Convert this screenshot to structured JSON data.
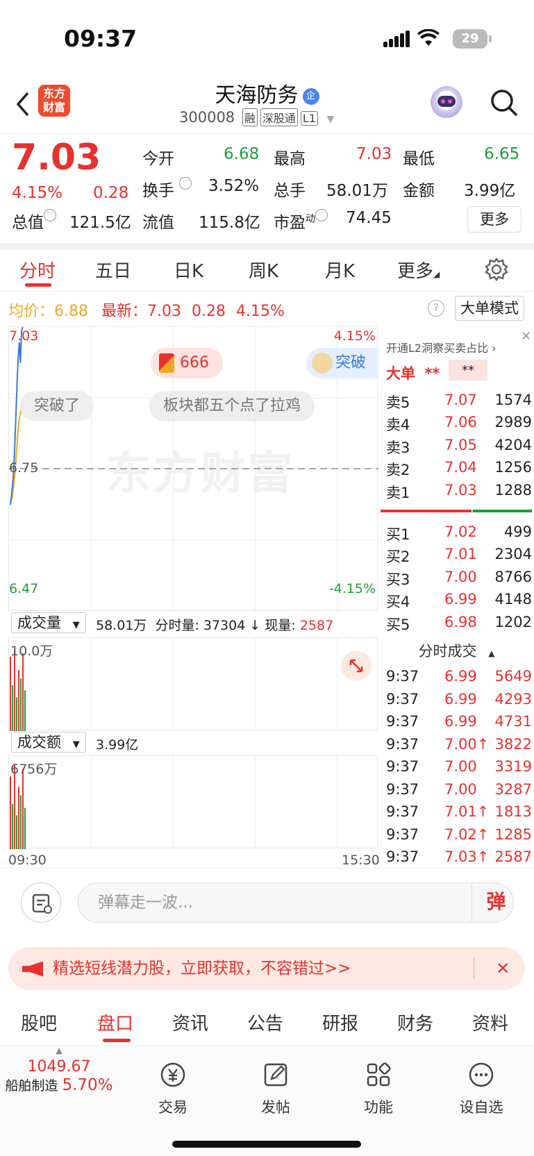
{
  "status": {
    "time": "09:37",
    "battery": "29"
  },
  "header": {
    "logo_line1": "东方",
    "logo_line2": "财富",
    "title": "天海防务",
    "title_badge": "企",
    "code": "300008",
    "tags": [
      "融",
      "深股通",
      "L1"
    ]
  },
  "quote": {
    "price": "7.03",
    "change_pct": "4.15%",
    "change": "0.28",
    "fields": [
      {
        "label": "今开",
        "value": "6.68",
        "color": "green"
      },
      {
        "label": "最高",
        "value": "7.03",
        "color": "red"
      },
      {
        "label": "最低",
        "value": "6.65",
        "color": "green"
      },
      {
        "label": "换手",
        "value": "3.52%"
      },
      {
        "label": "总手",
        "value": "58.01万"
      },
      {
        "label": "金额",
        "value": "3.99亿"
      },
      {
        "label": "总值",
        "value": "121.5亿"
      },
      {
        "label": "流值",
        "value": "115.8亿"
      },
      {
        "label": "市盈",
        "label_sup": "动",
        "value": "74.45"
      }
    ],
    "more_label": "更多"
  },
  "chart_tabs": [
    "分时",
    "五日",
    "日K",
    "周K",
    "月K",
    "更多"
  ],
  "info": {
    "avg_label": "均价：",
    "avg": "6.88",
    "latest_label": "最新：",
    "latest": "7.03",
    "change": "0.28",
    "pct": "4.15%",
    "mode_label": "大单模式"
  },
  "chart_data": [
    {
      "type": "line",
      "title": "",
      "ymax_label": "7.03",
      "ymin_label": "6.47",
      "mid_label": "6.75",
      "pct_top": "4.15%",
      "pct_bottom": "-4.15%",
      "ylim": [
        6.47,
        7.03
      ],
      "x_start": "09:30",
      "x_end": "15:30",
      "series": [
        {
          "values": [
            6.68,
            6.7,
            6.72,
            6.75,
            6.8,
            6.86,
            6.92,
            6.97,
            7.0,
            6.96,
            7.02,
            7.03
          ]
        },
        {
          "values": [
            6.68,
            6.69,
            6.7,
            6.72,
            6.74,
            6.77,
            6.8,
            6.83,
            6.85,
            6.86,
            6.87,
            6.88
          ]
        }
      ]
    },
    {
      "type": "bar",
      "title": "成交量",
      "total": "58.01万",
      "segment_label": "分时量:",
      "segment_value": "37304",
      "current_label": "现量:",
      "current_value": "2587",
      "ymax_label": "10.0万",
      "ylim": [
        0,
        100000
      ],
      "values": [
        88000,
        54000,
        96000,
        40000,
        72000,
        62000,
        92000,
        48000
      ]
    },
    {
      "type": "bar",
      "title": "成交额",
      "total": "3.99亿",
      "ymax_label": "6756万",
      "ylim": [
        0,
        6756
      ],
      "values": [
        5800,
        3600,
        6756,
        2700,
        5000,
        4300,
        6400,
        3300
      ]
    }
  ],
  "danmaku": [
    "666",
    "突破了",
    "板块都五个点了拉鸡",
    "突破"
  ],
  "watermark": "东方财富",
  "orderbook": {
    "banner": "开通L2洞察买卖占比 ›",
    "big_label": "大单",
    "big_val1": "**",
    "big_val2": "**",
    "asks": [
      {
        "label": "卖5",
        "price": "7.07",
        "vol": "1574"
      },
      {
        "label": "卖4",
        "price": "7.06",
        "vol": "2989"
      },
      {
        "label": "卖3",
        "price": "7.05",
        "vol": "4204"
      },
      {
        "label": "卖2",
        "price": "7.04",
        "vol": "1256"
      },
      {
        "label": "卖1",
        "price": "7.03",
        "vol": "1288"
      }
    ],
    "bids": [
      {
        "label": "买1",
        "price": "7.02",
        "vol": "499"
      },
      {
        "label": "买2",
        "price": "7.01",
        "vol": "2304"
      },
      {
        "label": "买3",
        "price": "7.00",
        "vol": "8766"
      },
      {
        "label": "买4",
        "price": "6.99",
        "vol": "4148"
      },
      {
        "label": "买5",
        "price": "6.98",
        "vol": "1202"
      }
    ],
    "buy_ratio": 0.6
  },
  "trades": {
    "title": "分时成交",
    "rows": [
      {
        "time": "9:37",
        "price": "6.99",
        "vol": "5649"
      },
      {
        "time": "9:37",
        "price": "6.99",
        "vol": "4293"
      },
      {
        "time": "9:37",
        "price": "6.99",
        "vol": "4731"
      },
      {
        "time": "9:37",
        "price": "7.00↑",
        "vol": "3822"
      },
      {
        "time": "9:37",
        "price": "7.00",
        "vol": "3319"
      },
      {
        "time": "9:37",
        "price": "7.00",
        "vol": "3287"
      },
      {
        "time": "9:37",
        "price": "7.01↑",
        "vol": "1813"
      },
      {
        "time": "9:37",
        "price": "7.02↑",
        "vol": "1285"
      },
      {
        "time": "9:37",
        "price": "7.03↑",
        "vol": "2587"
      }
    ]
  },
  "danmu_bar": {
    "placeholder": "弹幕走一波...",
    "button": "弹"
  },
  "promo": {
    "text": "精选短线潜力股，立即获取，不容错过>>"
  },
  "bottom_nav": [
    "股吧",
    "盘口",
    "资讯",
    "公告",
    "研报",
    "财务",
    "资料"
  ],
  "tabbar": {
    "index_value": "1049.67",
    "index_name": "船舶制造",
    "index_pct": "5.70%",
    "items": [
      "交易",
      "发帖",
      "功能",
      "设自选"
    ]
  },
  "colors": {
    "up": "#e8312d",
    "down": "#1e9e3a",
    "avg": "#f0a91f",
    "price_line": "#3a7ad6"
  }
}
